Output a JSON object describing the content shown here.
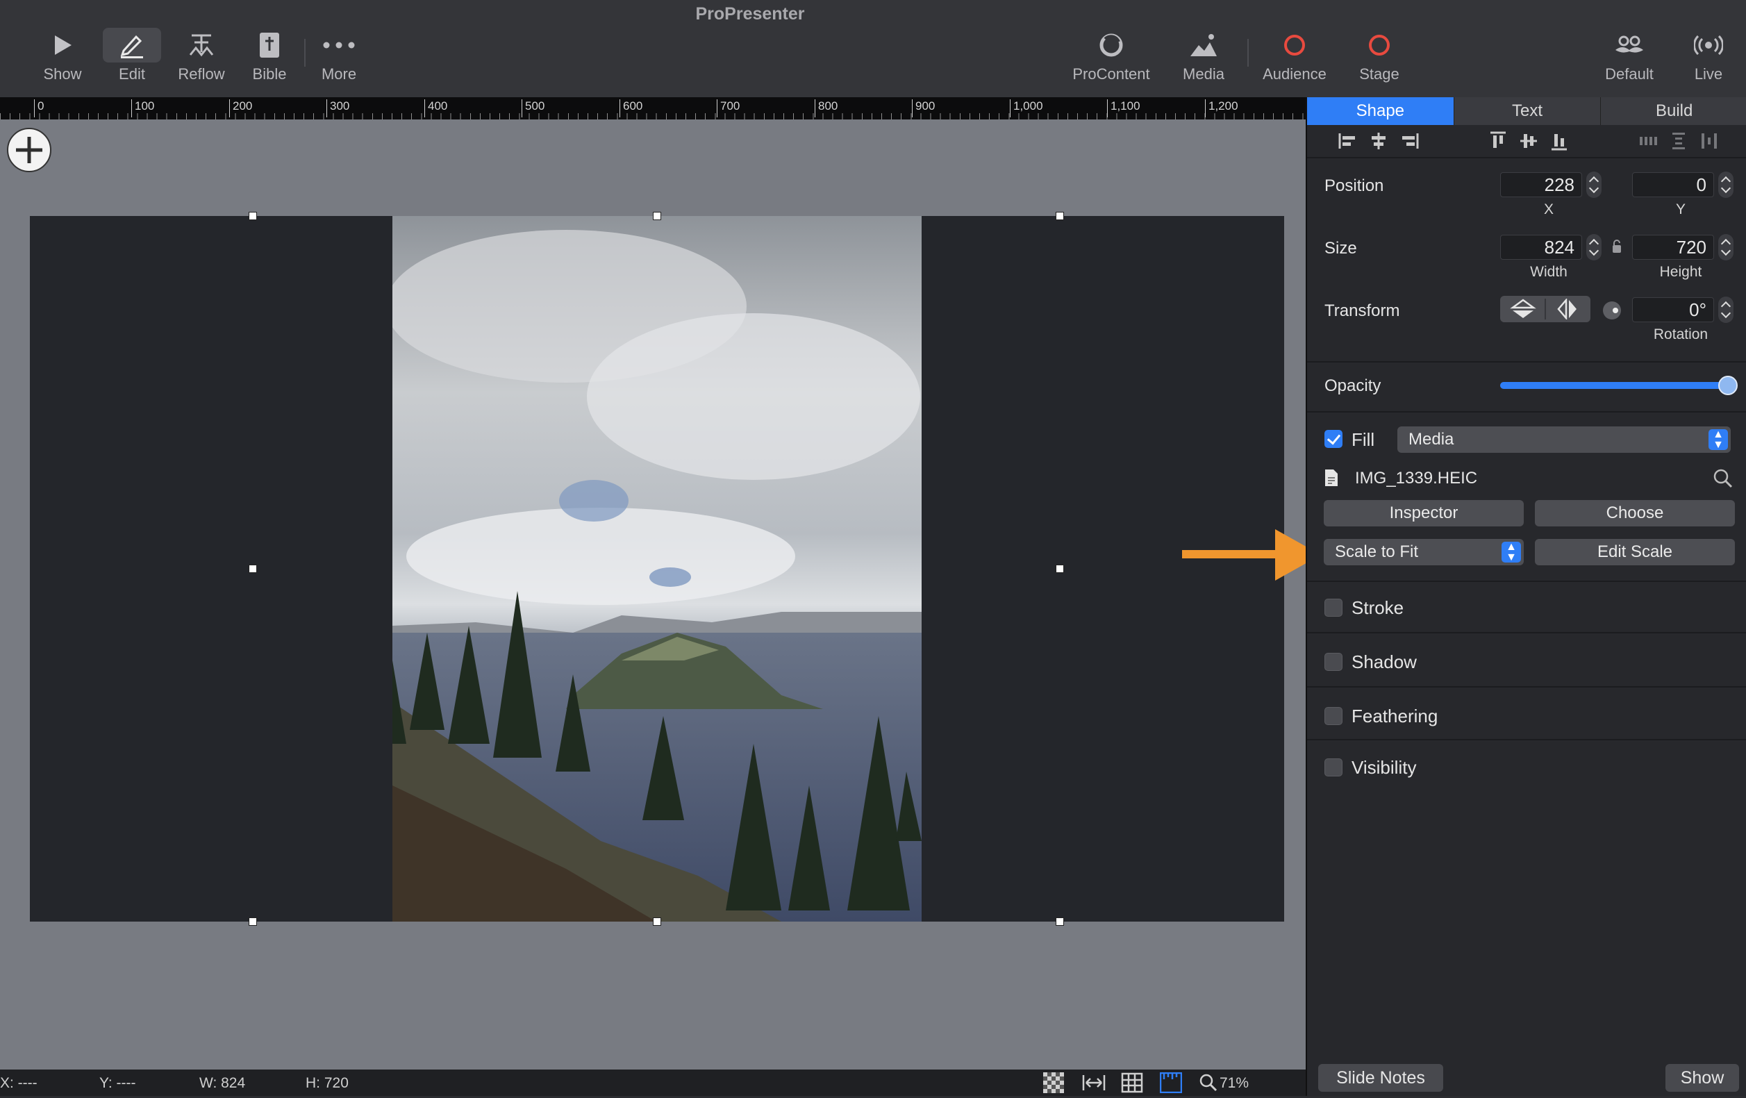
{
  "app": {
    "title": "ProPresenter"
  },
  "toolbar": {
    "left": [
      {
        "label": "Show",
        "icon": "play-icon"
      },
      {
        "label": "Edit",
        "icon": "pencil-icon",
        "active": true
      },
      {
        "label": "Reflow",
        "icon": "reflow-icon"
      },
      {
        "label": "Bible",
        "icon": "bible-icon"
      },
      {
        "label": "More",
        "icon": "more-icon"
      }
    ],
    "right": [
      {
        "label": "ProContent",
        "icon": "procontent-icon"
      },
      {
        "label": "Media",
        "icon": "media-icon"
      },
      {
        "label": "Audience",
        "icon": "audience-icon",
        "color": "#e84a3f"
      },
      {
        "label": "Stage",
        "icon": "stage-icon",
        "color": "#e84a3f"
      },
      {
        "label": "Default",
        "icon": "mustache-icon"
      },
      {
        "label": "Live",
        "icon": "live-icon"
      }
    ]
  },
  "ruler": {
    "marks": [
      "0",
      "100",
      "200",
      "300",
      "400",
      "500",
      "600",
      "700",
      "800",
      "900",
      "1,000",
      "1,100",
      "1,200"
    ]
  },
  "status": {
    "x": "X: ----",
    "y": "Y: ----",
    "w": "W: 824",
    "h": "H: 720",
    "zoom": "71%"
  },
  "inspector": {
    "tabs": [
      "Shape",
      "Text",
      "Build"
    ],
    "active_tab": "Shape",
    "position": {
      "label": "Position",
      "x": "228",
      "y": "0",
      "x_label": "X",
      "y_label": "Y"
    },
    "size": {
      "label": "Size",
      "width": "824",
      "height": "720",
      "width_label": "Width",
      "height_label": "Height"
    },
    "transform": {
      "label": "Transform",
      "rotation": "0°",
      "rotation_label": "Rotation"
    },
    "opacity": {
      "label": "Opacity",
      "value": 1.0
    },
    "fill": {
      "label": "Fill",
      "checked": true,
      "type": "Media",
      "file": "IMG_1339.HEIC",
      "inspector_btn": "Inspector",
      "choose_btn": "Choose",
      "scale_mode": "Scale to Fit",
      "edit_scale_btn": "Edit Scale"
    },
    "sections": [
      {
        "label": "Stroke",
        "checked": false
      },
      {
        "label": "Shadow",
        "checked": false
      },
      {
        "label": "Feathering",
        "checked": false
      },
      {
        "label": "Visibility",
        "checked": false
      }
    ],
    "footer": {
      "slide_notes": "Slide Notes",
      "show": "Show"
    }
  },
  "colors": {
    "accent": "#2f7ef6",
    "annotation_arrow": "#f0962e",
    "record_red": "#e84a3f"
  }
}
